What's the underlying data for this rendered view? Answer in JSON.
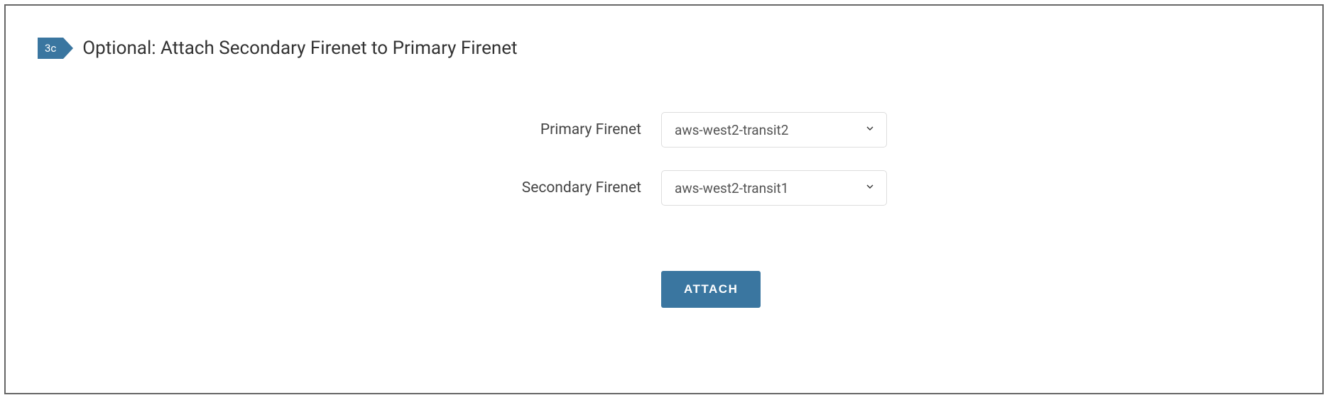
{
  "step": {
    "badge": "3c",
    "title": "Optional: Attach Secondary Firenet to Primary Firenet"
  },
  "form": {
    "primary": {
      "label": "Primary Firenet",
      "value": "aws-west2-transit2"
    },
    "secondary": {
      "label": "Secondary Firenet",
      "value": "aws-west2-transit1"
    }
  },
  "actions": {
    "attach": "ATTACH"
  }
}
